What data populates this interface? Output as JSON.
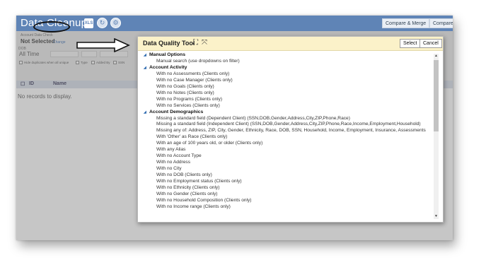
{
  "app": {
    "title": "Data Cleanup",
    "xls_label": "XLS",
    "buttons": {
      "compare_merge": "Compare & Merge",
      "compare": "Compare"
    }
  },
  "filters": {
    "account_check_label": "Account Data Check",
    "account_check_value": "Not Selected",
    "change_link": "Change",
    "dob_label": "DOB",
    "dob_value": "All Time",
    "checkbox_labels": [
      "Hide duplicates when all unique",
      "Type",
      "Added By",
      "SSN"
    ]
  },
  "grid": {
    "columns": [
      "ID",
      "Name"
    ],
    "empty_message": "No records to display."
  },
  "dialog": {
    "title": "Data Quality Tool",
    "select_label": "Select",
    "cancel_label": "Cancel",
    "groups": [
      {
        "name": "Manual Options",
        "items": [
          "Manual search (use dropdowns on filter)"
        ]
      },
      {
        "name": "Account Activity",
        "items": [
          "With no Assessments (Clients only)",
          "With no Case Manager (Clients only)",
          "With no Goals (Clients only)",
          "With no Notes (Clients only)",
          "With no Programs (Clients only)",
          "With no Services (Clients only)"
        ]
      },
      {
        "name": "Account Demographics",
        "items": [
          "Missing a standard field (Dependent Client) (SSN,DOB,Gender,Address,City,ZIP,Phone,Race)",
          "Missing a standard field (Independent Client) (SSN,DOB,Gender,Address,City,ZIP,Phone,Race,Income,Employment,Household)",
          "Missing any of: Address, ZIP, City, Gender, Ethnicity, Race, DOB, SSN, Household, Income, Employment, Insurance, Assessments",
          "With 'Other' as Race (Clients only)",
          "With an age of 100 years old, or older (Clients only)",
          "With any Alias",
          "With no Account Type",
          "With no Address",
          "With no City",
          "With no DOB (Clients only)",
          "With no Employment status (Clients only)",
          "With no Ethnicity (Clients only)",
          "With no Gender (Clients only)",
          "With no Household Composition (Clients only)",
          "With no Income range (Clients only)"
        ]
      }
    ]
  },
  "icons": {
    "expand": "expand-icon",
    "collapse": "collapse-icon",
    "group_toggle": "triangle-down-icon",
    "arrow": "right-arrow-annotation"
  },
  "colors": {
    "header": "#5f84b6",
    "dialog_titlebar": "#fbf2c9",
    "group_toggle": "#2e6bb0"
  }
}
